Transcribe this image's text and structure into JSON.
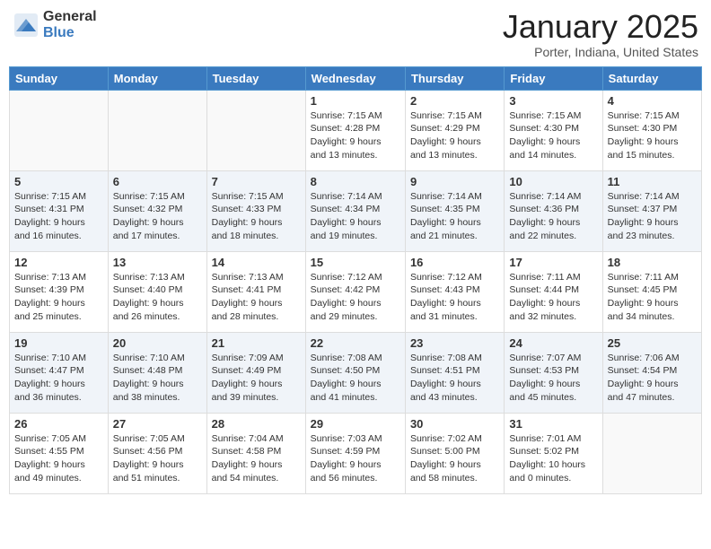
{
  "header": {
    "logo_general": "General",
    "logo_blue": "Blue",
    "month_title": "January 2025",
    "location": "Porter, Indiana, United States"
  },
  "weekdays": [
    "Sunday",
    "Monday",
    "Tuesday",
    "Wednesday",
    "Thursday",
    "Friday",
    "Saturday"
  ],
  "weeks": [
    [
      {
        "day": "",
        "info": ""
      },
      {
        "day": "",
        "info": ""
      },
      {
        "day": "",
        "info": ""
      },
      {
        "day": "1",
        "info": "Sunrise: 7:15 AM\nSunset: 4:28 PM\nDaylight: 9 hours\nand 13 minutes."
      },
      {
        "day": "2",
        "info": "Sunrise: 7:15 AM\nSunset: 4:29 PM\nDaylight: 9 hours\nand 13 minutes."
      },
      {
        "day": "3",
        "info": "Sunrise: 7:15 AM\nSunset: 4:30 PM\nDaylight: 9 hours\nand 14 minutes."
      },
      {
        "day": "4",
        "info": "Sunrise: 7:15 AM\nSunset: 4:30 PM\nDaylight: 9 hours\nand 15 minutes."
      }
    ],
    [
      {
        "day": "5",
        "info": "Sunrise: 7:15 AM\nSunset: 4:31 PM\nDaylight: 9 hours\nand 16 minutes."
      },
      {
        "day": "6",
        "info": "Sunrise: 7:15 AM\nSunset: 4:32 PM\nDaylight: 9 hours\nand 17 minutes."
      },
      {
        "day": "7",
        "info": "Sunrise: 7:15 AM\nSunset: 4:33 PM\nDaylight: 9 hours\nand 18 minutes."
      },
      {
        "day": "8",
        "info": "Sunrise: 7:14 AM\nSunset: 4:34 PM\nDaylight: 9 hours\nand 19 minutes."
      },
      {
        "day": "9",
        "info": "Sunrise: 7:14 AM\nSunset: 4:35 PM\nDaylight: 9 hours\nand 21 minutes."
      },
      {
        "day": "10",
        "info": "Sunrise: 7:14 AM\nSunset: 4:36 PM\nDaylight: 9 hours\nand 22 minutes."
      },
      {
        "day": "11",
        "info": "Sunrise: 7:14 AM\nSunset: 4:37 PM\nDaylight: 9 hours\nand 23 minutes."
      }
    ],
    [
      {
        "day": "12",
        "info": "Sunrise: 7:13 AM\nSunset: 4:39 PM\nDaylight: 9 hours\nand 25 minutes."
      },
      {
        "day": "13",
        "info": "Sunrise: 7:13 AM\nSunset: 4:40 PM\nDaylight: 9 hours\nand 26 minutes."
      },
      {
        "day": "14",
        "info": "Sunrise: 7:13 AM\nSunset: 4:41 PM\nDaylight: 9 hours\nand 28 minutes."
      },
      {
        "day": "15",
        "info": "Sunrise: 7:12 AM\nSunset: 4:42 PM\nDaylight: 9 hours\nand 29 minutes."
      },
      {
        "day": "16",
        "info": "Sunrise: 7:12 AM\nSunset: 4:43 PM\nDaylight: 9 hours\nand 31 minutes."
      },
      {
        "day": "17",
        "info": "Sunrise: 7:11 AM\nSunset: 4:44 PM\nDaylight: 9 hours\nand 32 minutes."
      },
      {
        "day": "18",
        "info": "Sunrise: 7:11 AM\nSunset: 4:45 PM\nDaylight: 9 hours\nand 34 minutes."
      }
    ],
    [
      {
        "day": "19",
        "info": "Sunrise: 7:10 AM\nSunset: 4:47 PM\nDaylight: 9 hours\nand 36 minutes."
      },
      {
        "day": "20",
        "info": "Sunrise: 7:10 AM\nSunset: 4:48 PM\nDaylight: 9 hours\nand 38 minutes."
      },
      {
        "day": "21",
        "info": "Sunrise: 7:09 AM\nSunset: 4:49 PM\nDaylight: 9 hours\nand 39 minutes."
      },
      {
        "day": "22",
        "info": "Sunrise: 7:08 AM\nSunset: 4:50 PM\nDaylight: 9 hours\nand 41 minutes."
      },
      {
        "day": "23",
        "info": "Sunrise: 7:08 AM\nSunset: 4:51 PM\nDaylight: 9 hours\nand 43 minutes."
      },
      {
        "day": "24",
        "info": "Sunrise: 7:07 AM\nSunset: 4:53 PM\nDaylight: 9 hours\nand 45 minutes."
      },
      {
        "day": "25",
        "info": "Sunrise: 7:06 AM\nSunset: 4:54 PM\nDaylight: 9 hours\nand 47 minutes."
      }
    ],
    [
      {
        "day": "26",
        "info": "Sunrise: 7:05 AM\nSunset: 4:55 PM\nDaylight: 9 hours\nand 49 minutes."
      },
      {
        "day": "27",
        "info": "Sunrise: 7:05 AM\nSunset: 4:56 PM\nDaylight: 9 hours\nand 51 minutes."
      },
      {
        "day": "28",
        "info": "Sunrise: 7:04 AM\nSunset: 4:58 PM\nDaylight: 9 hours\nand 54 minutes."
      },
      {
        "day": "29",
        "info": "Sunrise: 7:03 AM\nSunset: 4:59 PM\nDaylight: 9 hours\nand 56 minutes."
      },
      {
        "day": "30",
        "info": "Sunrise: 7:02 AM\nSunset: 5:00 PM\nDaylight: 9 hours\nand 58 minutes."
      },
      {
        "day": "31",
        "info": "Sunrise: 7:01 AM\nSunset: 5:02 PM\nDaylight: 10 hours\nand 0 minutes."
      },
      {
        "day": "",
        "info": ""
      }
    ]
  ]
}
